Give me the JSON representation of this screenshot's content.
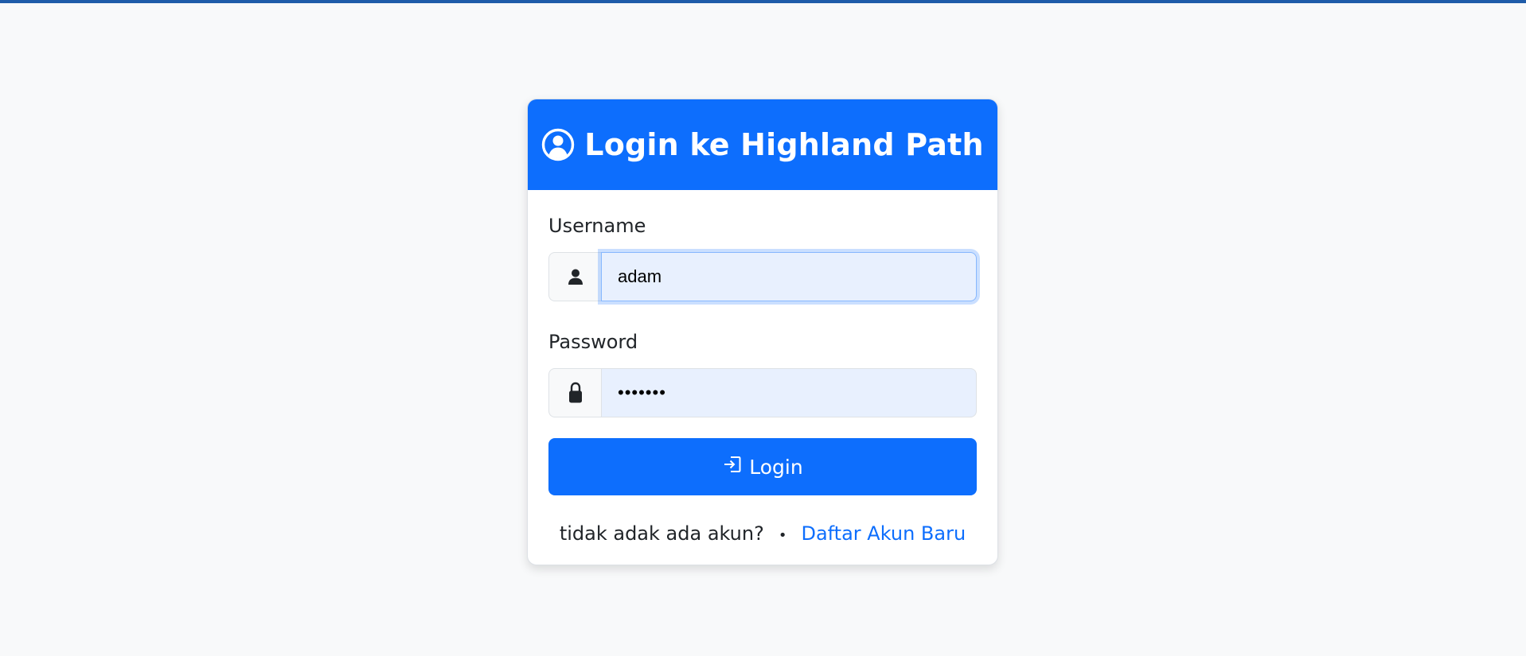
{
  "header": {
    "title": "Login ke Highland Path",
    "icon": "user-circle-icon"
  },
  "form": {
    "username": {
      "label": "Username",
      "value": "adam",
      "icon": "user-icon"
    },
    "password": {
      "label": "Password",
      "value": "•••••••",
      "icon": "lock-icon"
    },
    "submit_label": "Login",
    "submit_icon": "login-arrow-icon"
  },
  "footer": {
    "question": "tidak adak ada akun?",
    "separator": "•",
    "register_link": "Daftar Akun Baru"
  },
  "colors": {
    "primary": "#0d6efd",
    "top_strip": "#1f5ca9",
    "background": "#f8f9fa",
    "autofill": "#e8f0fe"
  }
}
